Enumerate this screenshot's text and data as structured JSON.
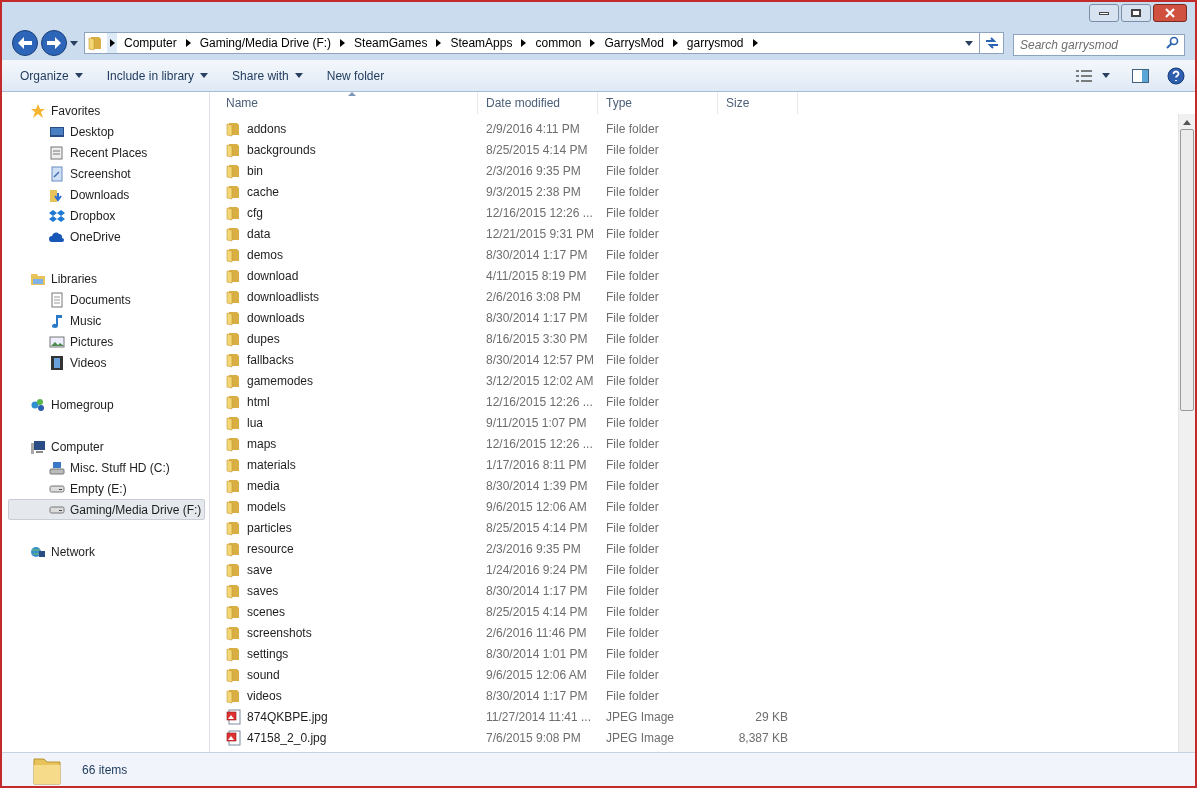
{
  "address_bar": {
    "crumbs": [
      "Computer",
      "Gaming/Media Drive (F:)",
      "SteamGames",
      "SteamApps",
      "common",
      "GarrysMod",
      "garrysmod"
    ]
  },
  "search": {
    "placeholder": "Search garrysmod"
  },
  "toolbar": {
    "buttons": [
      {
        "label": "Organize",
        "dropdown": true
      },
      {
        "label": "Include in library",
        "dropdown": true
      },
      {
        "label": "Share with",
        "dropdown": true
      },
      {
        "label": "New folder",
        "dropdown": false
      }
    ]
  },
  "navigation": [
    {
      "label": "Favorites",
      "kind": "star",
      "selected": false,
      "children": [
        {
          "label": "Desktop",
          "kind": "desktop",
          "selected": false
        },
        {
          "label": "Recent Places",
          "kind": "recent",
          "selected": false
        },
        {
          "label": "Screenshot",
          "kind": "shortcut",
          "selected": false
        },
        {
          "label": "Downloads",
          "kind": "download",
          "selected": false
        },
        {
          "label": "Dropbox",
          "kind": "dropbox",
          "selected": false
        },
        {
          "label": "OneDrive",
          "kind": "cloud",
          "selected": false
        }
      ]
    },
    {
      "label": "Libraries",
      "kind": "library",
      "selected": false,
      "children": [
        {
          "label": "Documents",
          "kind": "document",
          "selected": false
        },
        {
          "label": "Music",
          "kind": "music",
          "selected": false
        },
        {
          "label": "Pictures",
          "kind": "picture",
          "selected": false
        },
        {
          "label": "Videos",
          "kind": "video",
          "selected": false
        }
      ]
    },
    {
      "label": "Homegroup",
      "kind": "homegroup",
      "selected": false
    },
    {
      "label": "Computer",
      "kind": "computer",
      "selected": false,
      "children": [
        {
          "label": "Misc. Stuff HD (C:)",
          "kind": "system-drive",
          "selected": false
        },
        {
          "label": "Empty (E:)",
          "kind": "drive",
          "selected": false
        },
        {
          "label": "Gaming/Media Drive (F:)",
          "kind": "drive",
          "selected": true
        }
      ]
    },
    {
      "label": "Network",
      "kind": "network",
      "selected": false
    }
  ],
  "table": {
    "columns": [
      {
        "label": "Name",
        "sorted": true
      },
      {
        "label": "Date modified",
        "sorted": false
      },
      {
        "label": "Type",
        "sorted": false
      },
      {
        "label": "Size",
        "sorted": false
      }
    ],
    "rows": [
      {
        "kind": "folder",
        "name": "addons",
        "date": "2/9/2016 4:11 PM",
        "type": "File folder"
      },
      {
        "kind": "folder",
        "name": "backgrounds",
        "date": "8/25/2015 4:14 PM",
        "type": "File folder"
      },
      {
        "kind": "folder",
        "name": "bin",
        "date": "2/3/2016 9:35 PM",
        "type": "File folder"
      },
      {
        "kind": "folder",
        "name": "cache",
        "date": "9/3/2015 2:38 PM",
        "type": "File folder"
      },
      {
        "kind": "folder",
        "name": "cfg",
        "date": "12/16/2015 12:26 ...",
        "type": "File folder"
      },
      {
        "kind": "folder",
        "name": "data",
        "date": "12/21/2015 9:31 PM",
        "type": "File folder"
      },
      {
        "kind": "folder",
        "name": "demos",
        "date": "8/30/2014 1:17 PM",
        "type": "File folder"
      },
      {
        "kind": "folder",
        "name": "download",
        "date": "4/11/2015 8:19 PM",
        "type": "File folder"
      },
      {
        "kind": "folder",
        "name": "downloadlists",
        "date": "2/6/2016 3:08 PM",
        "type": "File folder"
      },
      {
        "kind": "folder",
        "name": "downloads",
        "date": "8/30/2014 1:17 PM",
        "type": "File folder"
      },
      {
        "kind": "folder",
        "name": "dupes",
        "date": "8/16/2015 3:30 PM",
        "type": "File folder"
      },
      {
        "kind": "folder",
        "name": "fallbacks",
        "date": "8/30/2014 12:57 PM",
        "type": "File folder"
      },
      {
        "kind": "folder",
        "name": "gamemodes",
        "date": "3/12/2015 12:02 AM",
        "type": "File folder"
      },
      {
        "kind": "folder",
        "name": "html",
        "date": "12/16/2015 12:26 ...",
        "type": "File folder"
      },
      {
        "kind": "folder",
        "name": "lua",
        "date": "9/11/2015 1:07 PM",
        "type": "File folder"
      },
      {
        "kind": "folder",
        "name": "maps",
        "date": "12/16/2015 12:26 ...",
        "type": "File folder"
      },
      {
        "kind": "folder",
        "name": "materials",
        "date": "1/17/2016 8:11 PM",
        "type": "File folder"
      },
      {
        "kind": "folder",
        "name": "media",
        "date": "8/30/2014 1:39 PM",
        "type": "File folder"
      },
      {
        "kind": "folder",
        "name": "models",
        "date": "9/6/2015 12:06 AM",
        "type": "File folder"
      },
      {
        "kind": "folder",
        "name": "particles",
        "date": "8/25/2015 4:14 PM",
        "type": "File folder"
      },
      {
        "kind": "folder",
        "name": "resource",
        "date": "2/3/2016 9:35 PM",
        "type": "File folder"
      },
      {
        "kind": "folder",
        "name": "save",
        "date": "1/24/2016 9:24 PM",
        "type": "File folder"
      },
      {
        "kind": "folder",
        "name": "saves",
        "date": "8/30/2014 1:17 PM",
        "type": "File folder"
      },
      {
        "kind": "folder",
        "name": "scenes",
        "date": "8/25/2015 4:14 PM",
        "type": "File folder"
      },
      {
        "kind": "folder",
        "name": "screenshots",
        "date": "2/6/2016 11:46 PM",
        "type": "File folder"
      },
      {
        "kind": "folder",
        "name": "settings",
        "date": "8/30/2014 1:01 PM",
        "type": "File folder"
      },
      {
        "kind": "folder",
        "name": "sound",
        "date": "9/6/2015 12:06 AM",
        "type": "File folder"
      },
      {
        "kind": "folder",
        "name": "videos",
        "date": "8/30/2014 1:17 PM",
        "type": "File folder"
      },
      {
        "kind": "image",
        "name": "874QKBPE.jpg",
        "date": "11/27/2014 11:41 ...",
        "type": "JPEG Image",
        "size": "29 KB"
      },
      {
        "kind": "image",
        "name": "47158_2_0.jpg",
        "date": "7/6/2015 9:08 PM",
        "type": "JPEG Image",
        "size": "8,387 KB"
      }
    ]
  },
  "status_bar": {
    "count": "66 items"
  }
}
